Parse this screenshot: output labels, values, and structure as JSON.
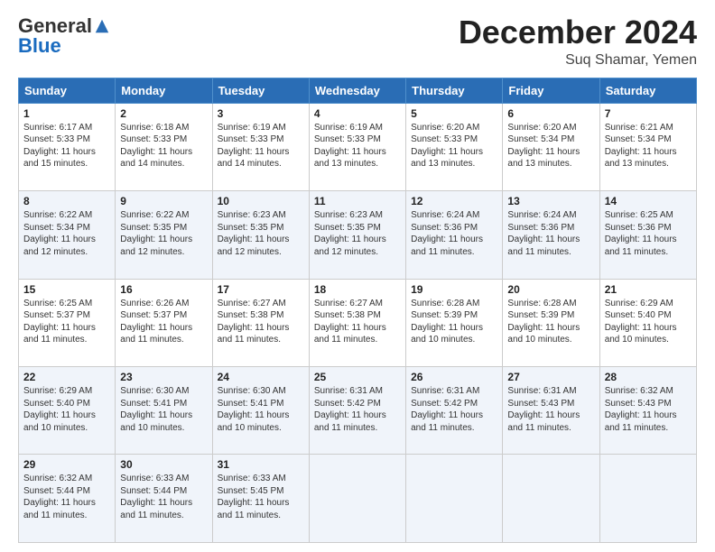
{
  "logo": {
    "general": "General",
    "blue": "Blue"
  },
  "title": "December 2024",
  "subtitle": "Suq Shamar, Yemen",
  "days": [
    "Sunday",
    "Monday",
    "Tuesday",
    "Wednesday",
    "Thursday",
    "Friday",
    "Saturday"
  ],
  "weeks": [
    [
      {
        "day": "1",
        "sunrise": "6:17 AM",
        "sunset": "5:33 PM",
        "daylight": "11 hours and 15 minutes."
      },
      {
        "day": "2",
        "sunrise": "6:18 AM",
        "sunset": "5:33 PM",
        "daylight": "11 hours and 14 minutes."
      },
      {
        "day": "3",
        "sunrise": "6:19 AM",
        "sunset": "5:33 PM",
        "daylight": "11 hours and 14 minutes."
      },
      {
        "day": "4",
        "sunrise": "6:19 AM",
        "sunset": "5:33 PM",
        "daylight": "11 hours and 13 minutes."
      },
      {
        "day": "5",
        "sunrise": "6:20 AM",
        "sunset": "5:33 PM",
        "daylight": "11 hours and 13 minutes."
      },
      {
        "day": "6",
        "sunrise": "6:20 AM",
        "sunset": "5:34 PM",
        "daylight": "11 hours and 13 minutes."
      },
      {
        "day": "7",
        "sunrise": "6:21 AM",
        "sunset": "5:34 PM",
        "daylight": "11 hours and 13 minutes."
      }
    ],
    [
      {
        "day": "8",
        "sunrise": "6:22 AM",
        "sunset": "5:34 PM",
        "daylight": "11 hours and 12 minutes."
      },
      {
        "day": "9",
        "sunrise": "6:22 AM",
        "sunset": "5:35 PM",
        "daylight": "11 hours and 12 minutes."
      },
      {
        "day": "10",
        "sunrise": "6:23 AM",
        "sunset": "5:35 PM",
        "daylight": "11 hours and 12 minutes."
      },
      {
        "day": "11",
        "sunrise": "6:23 AM",
        "sunset": "5:35 PM",
        "daylight": "11 hours and 12 minutes."
      },
      {
        "day": "12",
        "sunrise": "6:24 AM",
        "sunset": "5:36 PM",
        "daylight": "11 hours and 11 minutes."
      },
      {
        "day": "13",
        "sunrise": "6:24 AM",
        "sunset": "5:36 PM",
        "daylight": "11 hours and 11 minutes."
      },
      {
        "day": "14",
        "sunrise": "6:25 AM",
        "sunset": "5:36 PM",
        "daylight": "11 hours and 11 minutes."
      }
    ],
    [
      {
        "day": "15",
        "sunrise": "6:25 AM",
        "sunset": "5:37 PM",
        "daylight": "11 hours and 11 minutes."
      },
      {
        "day": "16",
        "sunrise": "6:26 AM",
        "sunset": "5:37 PM",
        "daylight": "11 hours and 11 minutes."
      },
      {
        "day": "17",
        "sunrise": "6:27 AM",
        "sunset": "5:38 PM",
        "daylight": "11 hours and 11 minutes."
      },
      {
        "day": "18",
        "sunrise": "6:27 AM",
        "sunset": "5:38 PM",
        "daylight": "11 hours and 11 minutes."
      },
      {
        "day": "19",
        "sunrise": "6:28 AM",
        "sunset": "5:39 PM",
        "daylight": "11 hours and 10 minutes."
      },
      {
        "day": "20",
        "sunrise": "6:28 AM",
        "sunset": "5:39 PM",
        "daylight": "11 hours and 10 minutes."
      },
      {
        "day": "21",
        "sunrise": "6:29 AM",
        "sunset": "5:40 PM",
        "daylight": "11 hours and 10 minutes."
      }
    ],
    [
      {
        "day": "22",
        "sunrise": "6:29 AM",
        "sunset": "5:40 PM",
        "daylight": "11 hours and 10 minutes."
      },
      {
        "day": "23",
        "sunrise": "6:30 AM",
        "sunset": "5:41 PM",
        "daylight": "11 hours and 10 minutes."
      },
      {
        "day": "24",
        "sunrise": "6:30 AM",
        "sunset": "5:41 PM",
        "daylight": "11 hours and 10 minutes."
      },
      {
        "day": "25",
        "sunrise": "6:31 AM",
        "sunset": "5:42 PM",
        "daylight": "11 hours and 11 minutes."
      },
      {
        "day": "26",
        "sunrise": "6:31 AM",
        "sunset": "5:42 PM",
        "daylight": "11 hours and 11 minutes."
      },
      {
        "day": "27",
        "sunrise": "6:31 AM",
        "sunset": "5:43 PM",
        "daylight": "11 hours and 11 minutes."
      },
      {
        "day": "28",
        "sunrise": "6:32 AM",
        "sunset": "5:43 PM",
        "daylight": "11 hours and 11 minutes."
      }
    ],
    [
      {
        "day": "29",
        "sunrise": "6:32 AM",
        "sunset": "5:44 PM",
        "daylight": "11 hours and 11 minutes."
      },
      {
        "day": "30",
        "sunrise": "6:33 AM",
        "sunset": "5:44 PM",
        "daylight": "11 hours and 11 minutes."
      },
      {
        "day": "31",
        "sunrise": "6:33 AM",
        "sunset": "5:45 PM",
        "daylight": "11 hours and 11 minutes."
      },
      null,
      null,
      null,
      null
    ]
  ]
}
